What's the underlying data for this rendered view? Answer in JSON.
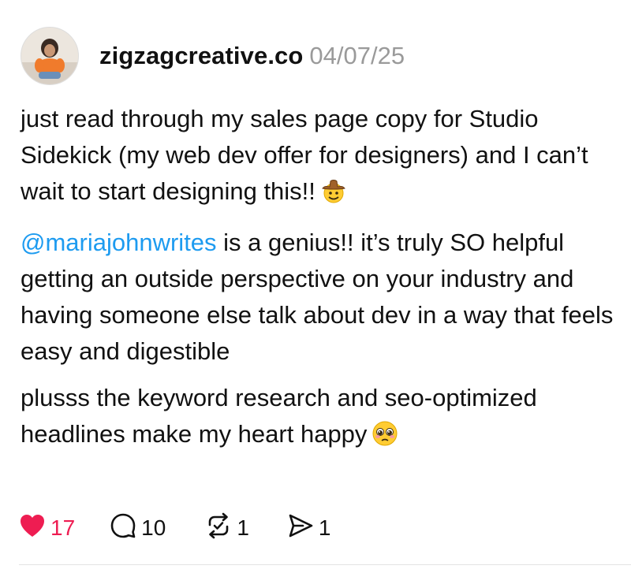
{
  "post": {
    "username": "zigzagcreative.co",
    "date": "04/07/25",
    "paragraphs": {
      "p1": "just read through my sales page copy for Studio Sidekick (my web dev offer for designers) and I can’t wait to start designing this!!",
      "p1_emoji": "cowboy-hat-face-emoji",
      "p2_mention": "@mariajohnwrites",
      "p2_rest": " is a genius!! it’s truly SO helpful getting an outside perspective on your industry and having someone else talk about dev in a way that feels easy and digestible",
      "p3": "plusss the keyword research and seo-optimized headlines make my heart happy",
      "p3_emoji": "pleading-face-emoji"
    },
    "stats": {
      "likes": "17",
      "replies": "10",
      "reposts": "1",
      "shares": "1"
    },
    "icons": {
      "like": "heart-icon",
      "reply": "speech-bubble-icon",
      "repost": "repost-icon",
      "share": "send-icon"
    },
    "colors": {
      "like": "#ee1d52",
      "mention": "#1d9bf0",
      "date": "#9a9a9a"
    }
  }
}
